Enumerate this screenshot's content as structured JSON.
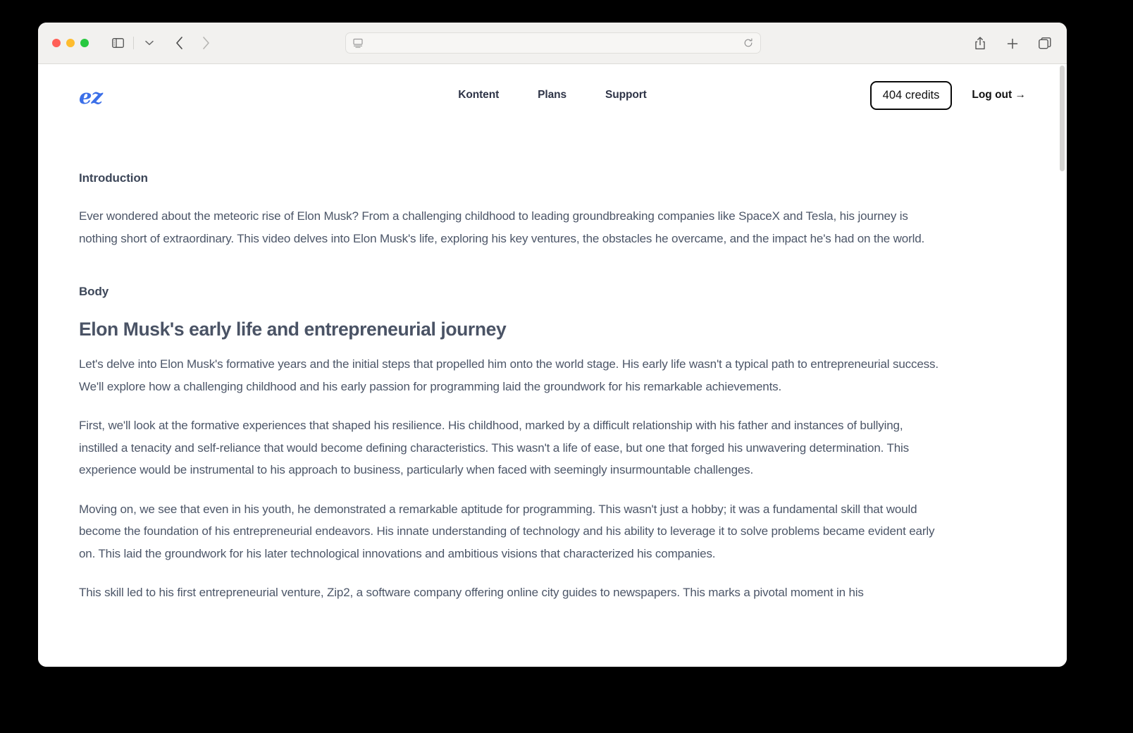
{
  "browser": {
    "traffic_lights": [
      "close",
      "minimize",
      "maximize"
    ],
    "sidebar_icon": "sidebar-icon",
    "tabgroup_icon": "chevron-down-icon",
    "back_label": "‹",
    "forward_label": "›",
    "address": {
      "value": "",
      "placeholder": "",
      "page_icon": "reader-view-icon",
      "reload_icon": "reload-icon"
    },
    "share_icon": "share-icon",
    "new_tab_icon": "plus-icon",
    "tabs_overview_icon": "tabs-overview-icon"
  },
  "site": {
    "logo_text": "ez",
    "logo_color": "#3b6fe8",
    "nav": [
      {
        "label": "Kontent"
      },
      {
        "label": "Plans"
      },
      {
        "label": "Support"
      }
    ],
    "credits_badge": "404 credits",
    "logout_label": "Log out →"
  },
  "article": {
    "intro_heading": "Introduction",
    "intro_paragraph": "Ever wondered about the meteoric rise of Elon Musk? From a challenging childhood to leading groundbreaking companies like SpaceX and Tesla, his journey is nothing short of extraordinary. This video delves into Elon Musk's life, exploring his key ventures, the obstacles he overcame, and the impact he's had on the world.",
    "body_heading": "Body",
    "section_heading": "Elon Musk's early life and entrepreneurial journey",
    "paragraphs": [
      "Let's delve into Elon Musk's formative years and the initial steps that propelled him onto the world stage. His early life wasn't a typical path to entrepreneurial success. We'll explore how a challenging childhood and his early passion for programming laid the groundwork for his remarkable achievements.",
      "First, we'll look at the formative experiences that shaped his resilience. His childhood, marked by a difficult relationship with his father and instances of bullying, instilled a tenacity and self-reliance that would become defining characteristics. This wasn't a life of ease, but one that forged his unwavering determination. This experience would be instrumental to his approach to business, particularly when faced with seemingly insurmountable challenges.",
      "Moving on, we see that even in his youth, he demonstrated a remarkable aptitude for programming. This wasn't just a hobby; it was a fundamental skill that would become the foundation of his entrepreneurial endeavors. His innate understanding of technology and his ability to leverage it to solve problems became evident early on. This laid the groundwork for his later technological innovations and ambitious visions that characterized his companies.",
      "This skill led to his first entrepreneurial venture, Zip2, a software company offering online city guides to newspapers. This marks a pivotal moment in his"
    ]
  }
}
